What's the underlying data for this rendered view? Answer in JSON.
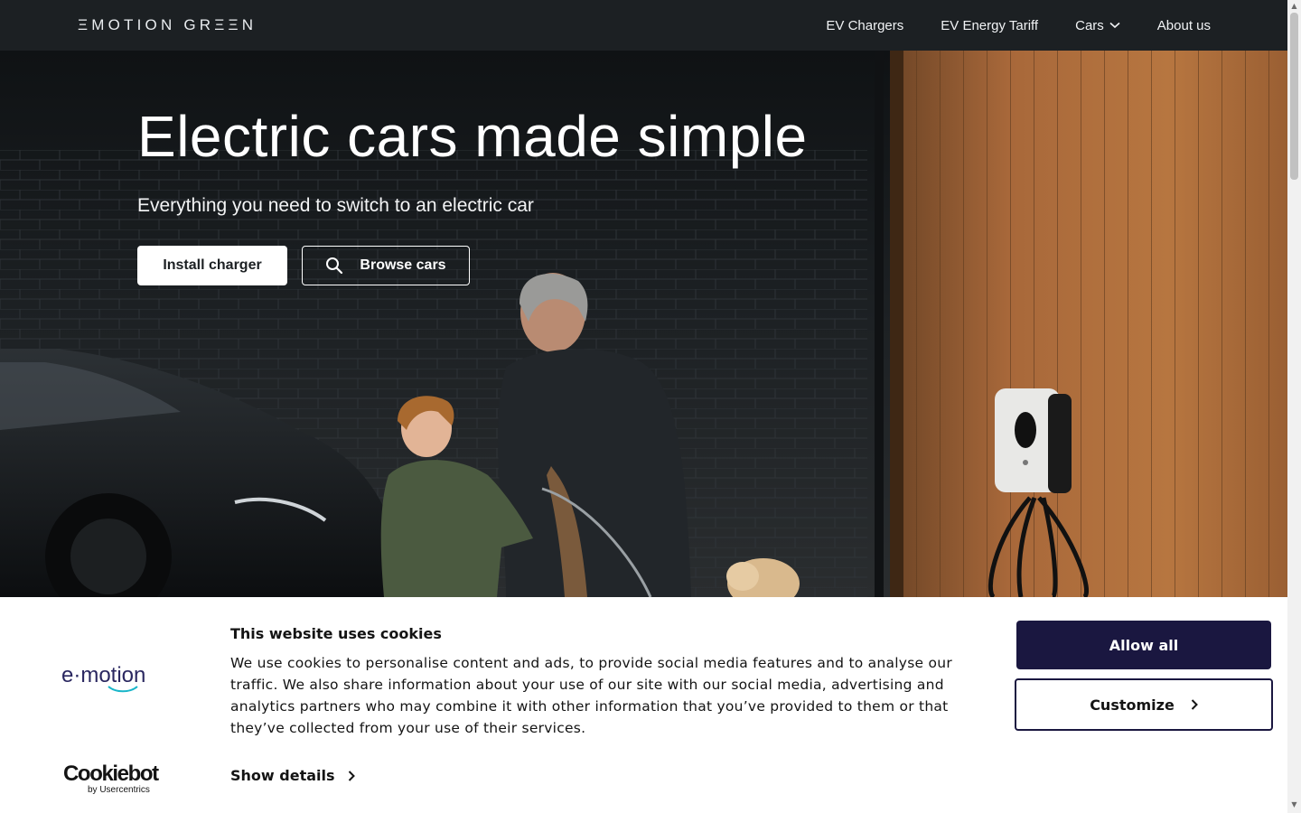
{
  "nav": {
    "logo": "ΞMOTION GRΞΞN",
    "links": [
      {
        "label": "EV Chargers"
      },
      {
        "label": "EV Energy Tariff"
      },
      {
        "label": "Cars",
        "icon": "chevron-down-icon"
      },
      {
        "label": "About us"
      }
    ]
  },
  "hero": {
    "title": "Electric cars made simple",
    "subtitle": "Everything you need to switch to an electric car",
    "primary_button": "Install charger",
    "secondary_button": "Browse cars",
    "secondary_icon": "search-icon"
  },
  "cookie_banner": {
    "brand": "e·motion",
    "title": "This website uses cookies",
    "body": "We use cookies to personalise content and ads, to provide social media features and to analyse our traffic. We also share information about your use of our site with our social media, advertising and analytics partners who may combine it with other information that you’ve provided to them or that they’ve collected from your use of their services.",
    "show_details": "Show details",
    "allow_all": "Allow all",
    "customize": "Customize",
    "provider_name": "Cookiebot",
    "provider_sub": "by Usercentrics",
    "accent_color": "#1a1740",
    "brand_color": "#2a2760",
    "brand_underline_color": "#19b6c9"
  }
}
